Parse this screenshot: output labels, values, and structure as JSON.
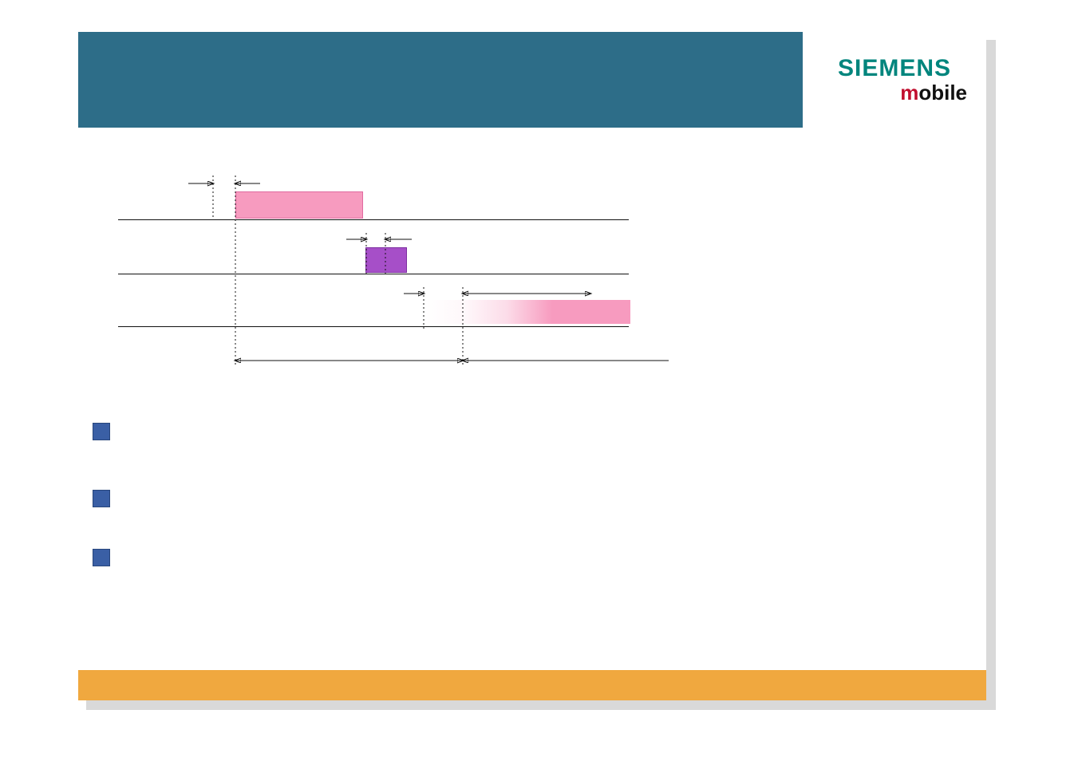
{
  "brand": {
    "name": "SIEMENS",
    "sub_prefix": "m",
    "sub_rest": "obile"
  },
  "colors": {
    "header": "#2d6d88",
    "footer": "#f0a83f",
    "bullet": "#3a5fa5",
    "pink": "#f79bbf",
    "purple": "#a64fc8",
    "siemens_text": "#00857d",
    "mobile_m": "#c10f2f"
  },
  "diagram": {
    "rows": 3,
    "bars": [
      {
        "row": 1,
        "color": "pink",
        "style": "solid"
      },
      {
        "row": 2,
        "color": "purple",
        "style": "solid"
      },
      {
        "row": 3,
        "color": "pink",
        "style": "faded-to-solid"
      }
    ],
    "arrow_markers": [
      {
        "pos": "row1-left-double-arrow"
      },
      {
        "pos": "row2-left-double-arrow"
      },
      {
        "pos": "row3-left-double-arrow"
      },
      {
        "pos": "row3-right-single-arrow"
      },
      {
        "pos": "bottom-left-span-arrow"
      },
      {
        "pos": "bottom-right-span-arrow"
      }
    ]
  },
  "bullets": {
    "count": 3
  }
}
